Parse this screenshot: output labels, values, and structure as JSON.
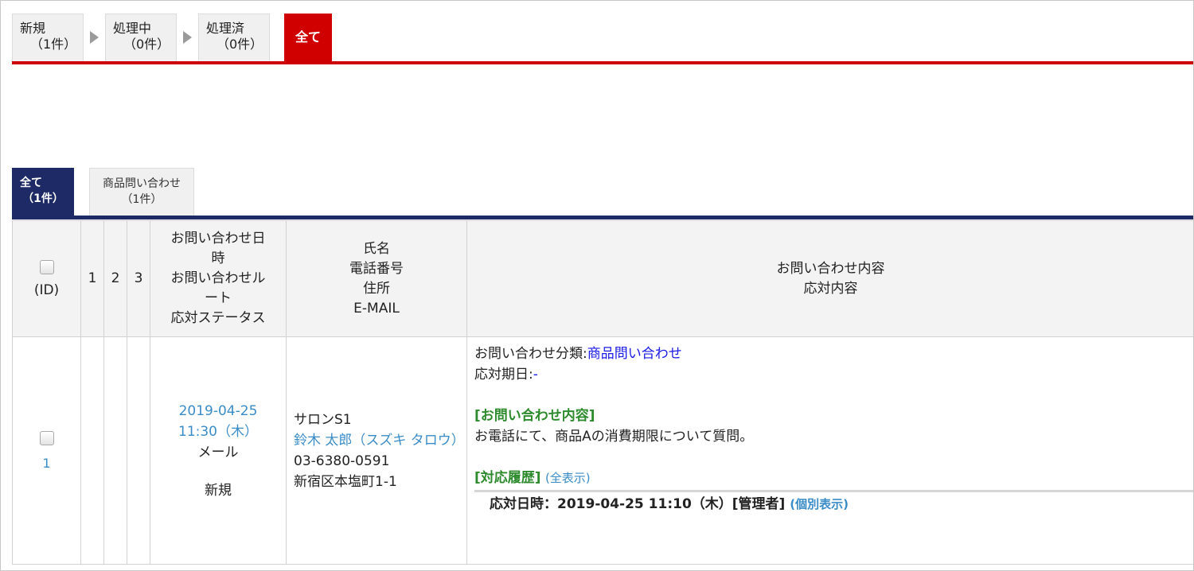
{
  "status_tabs": [
    {
      "label": "新規",
      "count": "（1件）"
    },
    {
      "label": "処理中",
      "count": "（0件）"
    },
    {
      "label": "処理済",
      "count": "（0件）"
    },
    {
      "label": "全て"
    }
  ],
  "category_tabs": [
    {
      "label": "全て",
      "count": "（1件）"
    },
    {
      "label": "商品問い合わせ",
      "count": "（1件）"
    }
  ],
  "table": {
    "headers": {
      "id_label": "(ID)",
      "col1": "1",
      "col2": "2",
      "col3": "3",
      "date_lines": [
        "お問い合わせ日",
        "時",
        "お問い合わせル",
        "ート",
        "応対ステータス"
      ],
      "person_lines": [
        "氏名",
        "電話番号",
        "住所",
        "E-MAIL"
      ],
      "content_lines": [
        "お問い合わせ内容",
        "応対内容"
      ]
    },
    "rows": [
      {
        "id": "1",
        "date": "2019-04-25",
        "time": "11:30（木）",
        "route": "メール",
        "status": "新規",
        "company": "サロンS1",
        "name": "鈴木 太郎（スズキ タロウ）",
        "phone": "03-6380-0591",
        "address": "新宿区本塩町1-1",
        "category_label": "お問い合わせ分類:",
        "category_value": "商品問い合わせ",
        "deadline_label": "応対期日:",
        "deadline_value": "-",
        "inquiry_heading": "[お問い合わせ内容]",
        "inquiry_text": "お電話にて、商品Aの消費期限について質問。",
        "history_heading": "[対応履歴]",
        "history_show_all": "(全表示)",
        "history_entry": "応対日時：2019-04-25 11:10（木）[管理者]",
        "history_detail": "(個別表示)"
      }
    ]
  }
}
